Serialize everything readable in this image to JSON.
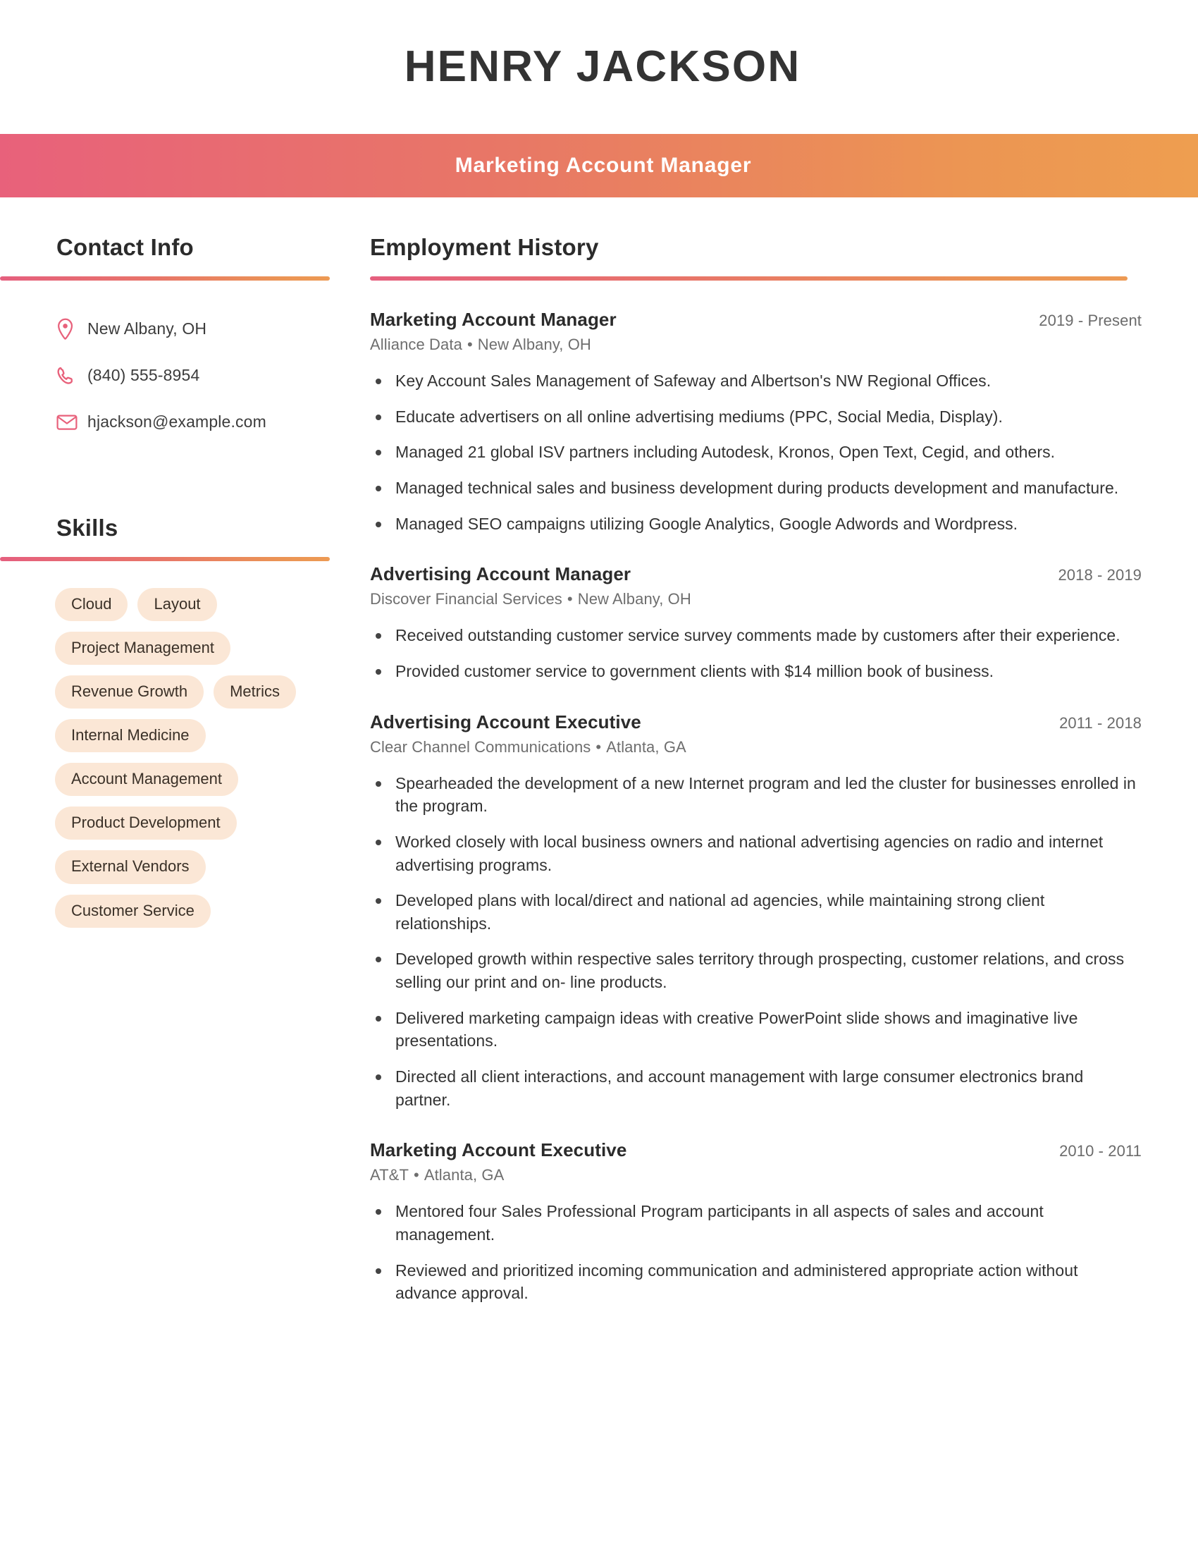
{
  "theme": {
    "gradient_start": "#e8617b",
    "gradient_end": "#ee9e50",
    "pill_bg": "#fbe7d6",
    "heading_color": "#2b2b2b",
    "icon_color": "#e8617b"
  },
  "header": {
    "full_name": "HENRY JACKSON",
    "job_title": "Marketing Account Manager"
  },
  "sidebar": {
    "contact": {
      "heading": "Contact Info",
      "items": [
        {
          "icon": "location-pin-icon",
          "text": "New Albany, OH"
        },
        {
          "icon": "phone-icon",
          "text": "(840) 555-8954"
        },
        {
          "icon": "envelope-icon",
          "text": "hjackson@example.com"
        }
      ]
    },
    "skills": {
      "heading": "Skills",
      "items": [
        "Cloud",
        "Layout",
        "Project Management",
        "Revenue Growth",
        "Metrics",
        "Internal Medicine",
        "Account Management",
        "Product Development",
        "External Vendors",
        "Customer Service"
      ]
    }
  },
  "main": {
    "employment": {
      "heading": "Employment History",
      "jobs": [
        {
          "role": "Marketing Account Manager",
          "dates": "2019 - Present",
          "company": "Alliance Data",
          "location": "New Albany, OH",
          "bullets": [
            "Key Account Sales Management of Safeway and Albertson's NW Regional Offices.",
            "Educate advertisers on all online advertising mediums (PPC, Social Media, Display).",
            "Managed 21 global ISV partners including Autodesk, Kronos, Open Text, Cegid, and others.",
            "Managed technical sales and business development during products development and manufacture.",
            "Managed SEO campaigns utilizing Google Analytics, Google Adwords and Wordpress."
          ]
        },
        {
          "role": "Advertising Account Manager",
          "dates": "2018 - 2019",
          "company": "Discover Financial Services",
          "location": "New Albany, OH",
          "bullets": [
            "Received outstanding customer service survey comments made by customers after their experience.",
            "Provided customer service to government clients with $14 million book of business."
          ]
        },
        {
          "role": "Advertising Account Executive",
          "dates": "2011 - 2018",
          "company": "Clear Channel Communications",
          "location": "Atlanta, GA",
          "bullets": [
            "Spearheaded the development of a new Internet program and led the cluster for businesses enrolled in the program.",
            "Worked closely with local business owners and national advertising agencies on radio and internet advertising programs.",
            "Developed plans with local/direct and national ad agencies, while maintaining strong client relationships.",
            "Developed growth within respective sales territory through prospecting, customer relations, and cross selling our print and on- line products.",
            "Delivered marketing campaign ideas with creative PowerPoint slide shows and imaginative live presentations.",
            "Directed all client interactions, and account management with large consumer electronics brand partner."
          ]
        },
        {
          "role": "Marketing Account Executive",
          "dates": "2010 - 2011",
          "company": "AT&T",
          "location": "Atlanta, GA",
          "bullets": [
            "Mentored four Sales Professional Program participants in all aspects of sales and account management.",
            "Reviewed and prioritized incoming communication and administered appropriate action without advance approval."
          ]
        }
      ]
    }
  }
}
